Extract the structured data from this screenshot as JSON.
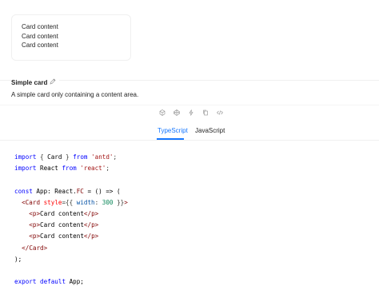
{
  "demo": {
    "lines": [
      "Card content",
      "Card content",
      "Card content"
    ]
  },
  "meta": {
    "title": "Simple card",
    "description": "A simple card only containing a content area."
  },
  "actions": [
    {
      "icon": "codesandbox-icon"
    },
    {
      "icon": "codepen-icon"
    },
    {
      "icon": "thunder-icon"
    },
    {
      "icon": "copy-icon"
    },
    {
      "icon": "code-icon"
    }
  ],
  "tabs": {
    "typescript": "TypeScript",
    "javascript": "JavaScript",
    "active": "TypeScript"
  },
  "code": {
    "l1": {
      "kw1": "import",
      "p1": " { ",
      "id": "Card",
      "p2": " } ",
      "kw2": "from",
      "sp": " ",
      "str": "'antd'",
      "end": ";"
    },
    "l2": {
      "kw1": "import",
      "id": " React ",
      "kw2": "from",
      "sp": " ",
      "str": "'react'",
      "end": ";"
    },
    "l4": {
      "kw": "const",
      "rest": " App: React.",
      "type": "FC",
      "tail": " = () => ("
    },
    "l5": {
      "open": "<",
      "tag": "Card",
      "attr": " style",
      "p1": "={{ ",
      "prop": "width",
      "p2": ": ",
      "num": "300",
      "p3": " }}",
      "close": ">"
    },
    "l6": {
      "tag": "p",
      "text": "Card content"
    },
    "l7": {
      "tag": "p",
      "text": "Card content"
    },
    "l8": {
      "tag": "p",
      "text": "Card content"
    },
    "l9": {
      "tag": "Card"
    },
    "l10": ");",
    "l12": {
      "kw1": "export",
      "kw2": " default",
      "rest": " App;"
    }
  }
}
